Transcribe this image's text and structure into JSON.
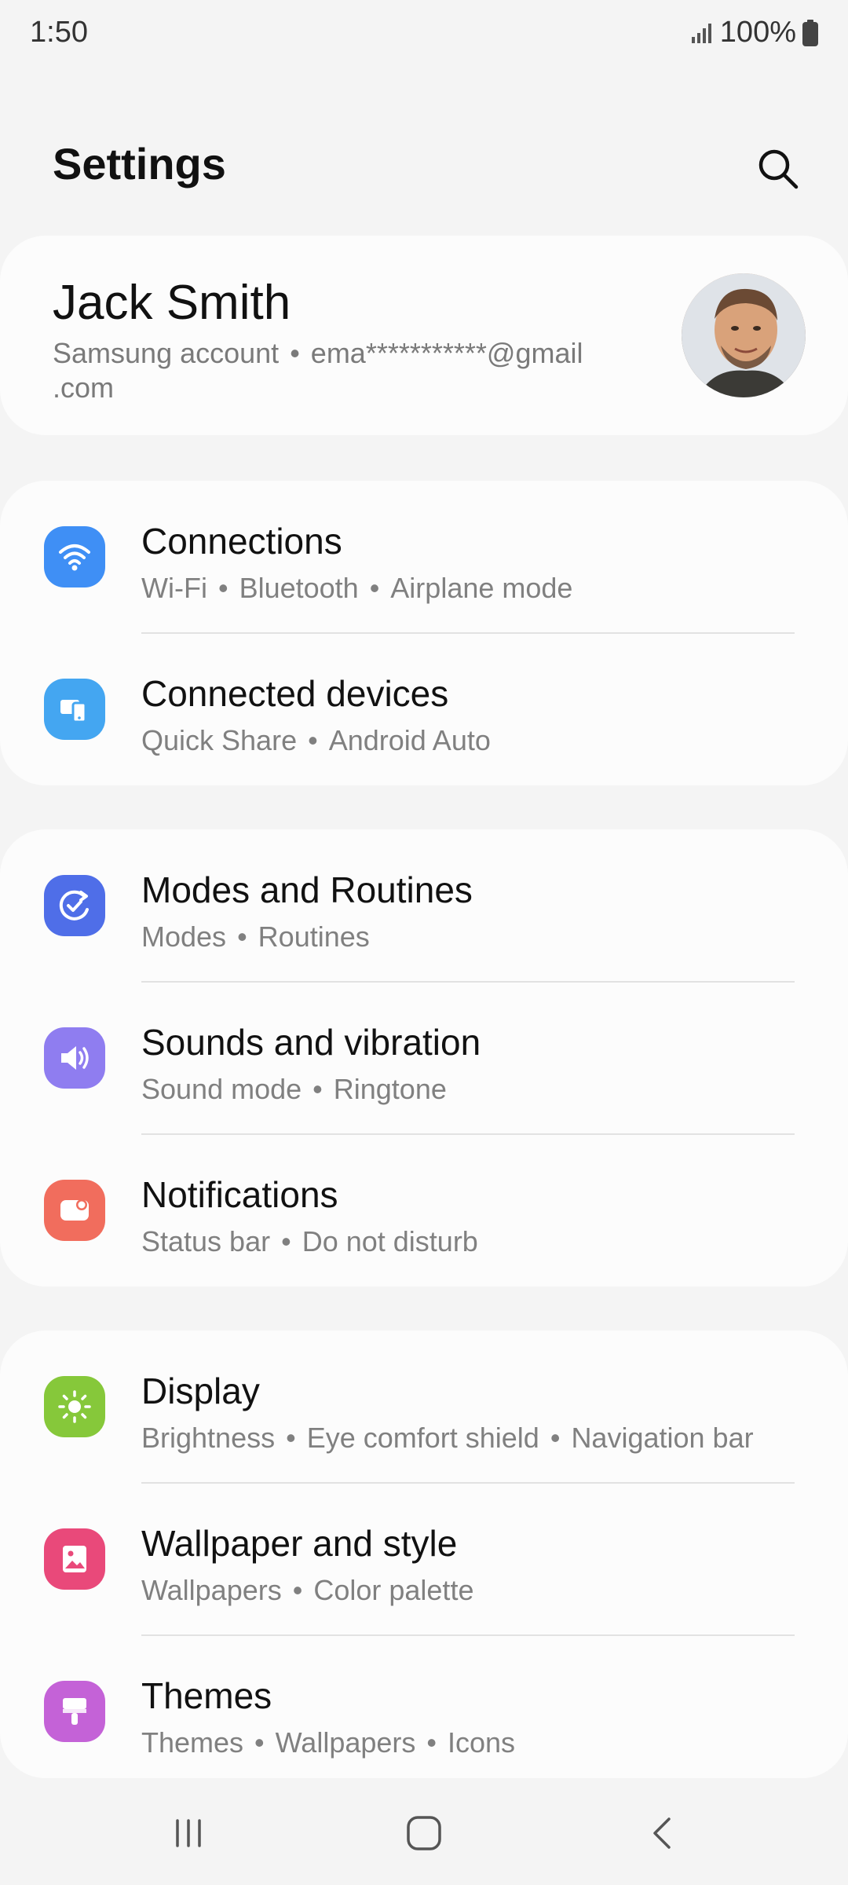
{
  "status": {
    "time": "1:50",
    "battery": "100%"
  },
  "header": {
    "title": "Settings"
  },
  "account": {
    "name": "Jack Smith",
    "label": "Samsung account",
    "email_line1": "ema***********@gmail",
    "email_line2": ".com"
  },
  "groups": [
    {
      "items": [
        {
          "title": "Connections",
          "subs": [
            "Wi-Fi",
            "Bluetooth",
            "Airplane mode"
          ],
          "icon": "wifi-icon",
          "color": "#3f8ff5"
        },
        {
          "title": "Connected devices",
          "subs": [
            "Quick Share",
            "Android Auto"
          ],
          "icon": "devices-icon",
          "color": "#44a6f1"
        }
      ]
    },
    {
      "items": [
        {
          "title": "Modes and Routines",
          "subs": [
            "Modes",
            "Routines"
          ],
          "icon": "routines-icon",
          "color": "#4f6ee8"
        },
        {
          "title": "Sounds and vibration",
          "subs": [
            "Sound mode",
            "Ringtone"
          ],
          "icon": "speaker-icon",
          "color": "#8f7df0"
        },
        {
          "title": "Notifications",
          "subs": [
            "Status bar",
            "Do not disturb"
          ],
          "icon": "notification-icon",
          "color": "#f16d5d"
        }
      ]
    },
    {
      "items": [
        {
          "title": "Display",
          "subs": [
            "Brightness",
            "Eye comfort shield",
            "Navigation bar"
          ],
          "icon": "sun-icon",
          "color": "#86c83a"
        },
        {
          "title": "Wallpaper and style",
          "subs": [
            "Wallpapers",
            "Color palette"
          ],
          "icon": "wallpaper-icon",
          "color": "#e9497a"
        },
        {
          "title": "Themes",
          "subs": [
            "Themes",
            "Wallpapers",
            "Icons"
          ],
          "icon": "themes-icon",
          "color": "#c462d7"
        }
      ]
    }
  ],
  "nav": {
    "recents": "recents-icon",
    "home": "home-icon",
    "back": "back-icon"
  }
}
